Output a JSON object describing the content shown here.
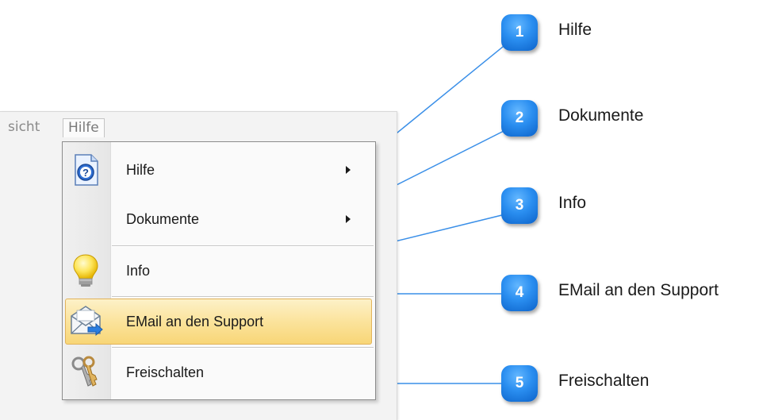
{
  "menubar": {
    "items": [
      {
        "label": "sicht"
      },
      {
        "label": "Hilfe"
      }
    ]
  },
  "menu": {
    "items": [
      {
        "label": "Hilfe",
        "icon": "help-icon",
        "has_submenu": true
      },
      {
        "label": "Dokumente",
        "icon": null,
        "has_submenu": true
      },
      {
        "label": "Info",
        "icon": "lightbulb-icon",
        "has_submenu": false
      },
      {
        "label": "EMail an den Support",
        "icon": "email-icon",
        "has_submenu": false,
        "highlighted": true
      },
      {
        "label": "Freischalten",
        "icon": "keys-icon",
        "has_submenu": false
      }
    ]
  },
  "callouts": [
    {
      "number": "1",
      "label": "Hilfe"
    },
    {
      "number": "2",
      "label": "Dokumente"
    },
    {
      "number": "3",
      "label": "Info"
    },
    {
      "number": "4",
      "label": "EMail an den Support"
    },
    {
      "number": "5",
      "label": "Freischalten"
    }
  ],
  "colors": {
    "callout_badge": "#1f7fe6",
    "callout_line": "#3a8fe8",
    "highlight": "#fbe39c"
  }
}
